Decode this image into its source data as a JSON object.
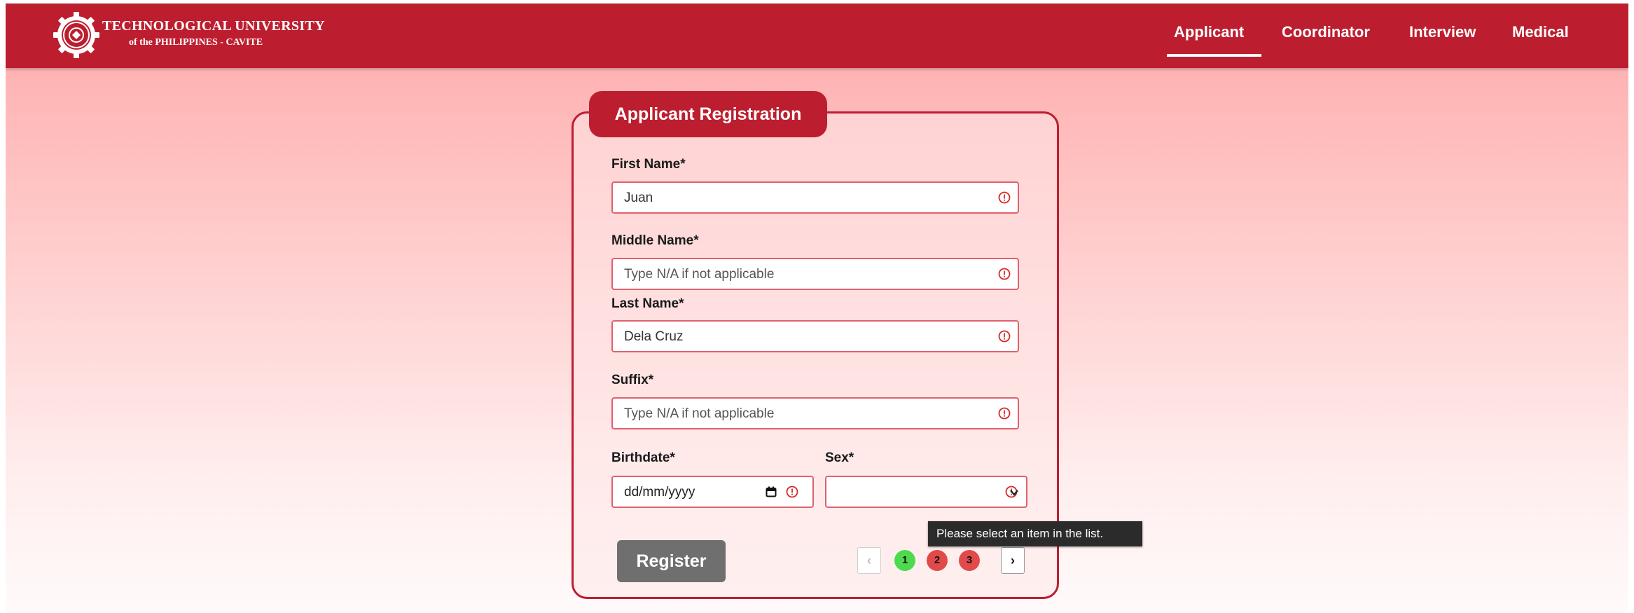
{
  "header": {
    "brand_line1": "TECHNOLOGICAL UNIVERSITY",
    "brand_line2": "of the PHILIPPINES - CAVITE",
    "logo_icon": "gear-seal-icon",
    "nav": [
      {
        "label": "Applicant",
        "active": true
      },
      {
        "label": "Coordinator",
        "active": false
      },
      {
        "label": "Interview",
        "active": false
      },
      {
        "label": "Medical",
        "active": false
      }
    ]
  },
  "form": {
    "title": "Applicant Registration",
    "fields": {
      "first_name": {
        "label": "First Name*",
        "value": "Juan",
        "placeholder": ""
      },
      "middle_name": {
        "label": "Middle Name*",
        "value": "",
        "placeholder": "Type N/A if not applicable"
      },
      "last_name": {
        "label": "Last Name*",
        "value": "Dela Cruz",
        "placeholder": ""
      },
      "suffix": {
        "label": "Suffix*",
        "value": "",
        "placeholder": "Type N/A if not applicable"
      },
      "birthdate": {
        "label": "Birthdate*",
        "value": "dd/mm/yyyy"
      },
      "sex": {
        "label": "Sex*",
        "value": ""
      }
    },
    "register_label": "Register",
    "validation_tooltip": "Please select an item in the list."
  },
  "pagination": {
    "prev_label": "‹",
    "next_label": "›",
    "pages": [
      {
        "number": "1",
        "status": "complete",
        "color": "#4ddb4d"
      },
      {
        "number": "2",
        "status": "incomplete",
        "color": "#e24a4a"
      },
      {
        "number": "3",
        "status": "incomplete",
        "color": "#e24a4a"
      }
    ]
  },
  "colors": {
    "brand": "#bd1e2f",
    "input_border": "#e0616e",
    "warning": "#d42b2b",
    "register_button": "#6f6f6f"
  }
}
